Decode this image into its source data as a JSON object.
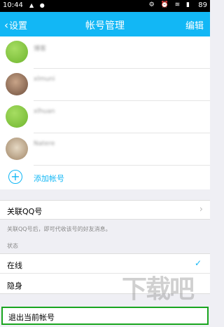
{
  "statusbar": {
    "time": "10:44",
    "battery": "89"
  },
  "nav": {
    "back_label": "设置",
    "title": "帐号管理",
    "edit_label": "编辑"
  },
  "accounts": [
    {
      "name": "博客",
      "avatar_color": "#7ec43c"
    },
    {
      "name": "xlmuni",
      "avatar_color": "#8a6a52"
    },
    {
      "name": "xlhuan",
      "avatar_color": "#7ec43c"
    },
    {
      "name": "Natere",
      "avatar_color": "#b9a58f"
    }
  ],
  "add_account_label": "添加帐号",
  "linked_qq": {
    "label": "关联QQ号",
    "hint": "关联QQ号后，即可代收该号的好友消息。"
  },
  "status_section": {
    "title": "状态",
    "options": [
      {
        "label": "在线",
        "selected": true
      },
      {
        "label": "隐身",
        "selected": false
      }
    ]
  },
  "logout_label": "退出当前帐号",
  "watermark": "下载吧",
  "colors": {
    "accent": "#12b7f5",
    "highlight_border": "#19a51f"
  }
}
